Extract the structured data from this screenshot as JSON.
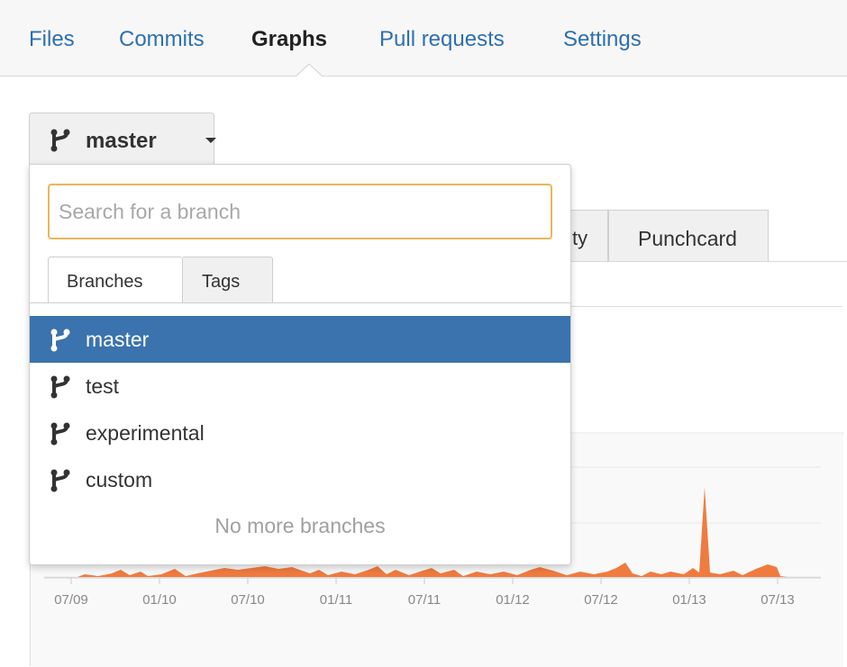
{
  "nav": {
    "tabs": [
      {
        "label": "Files"
      },
      {
        "label": "Commits"
      },
      {
        "label": "Graphs",
        "active": true
      },
      {
        "label": "Pull requests"
      },
      {
        "label": "Settings"
      }
    ]
  },
  "branch_selector": {
    "current": "master",
    "search_placeholder": "Search for a branch",
    "search_value": "",
    "tabs": [
      {
        "label": "Branches",
        "active": true
      },
      {
        "label": "Tags"
      }
    ],
    "branches": [
      {
        "name": "master",
        "selected": true
      },
      {
        "name": "test"
      },
      {
        "name": "experimental"
      },
      {
        "name": "custom"
      }
    ],
    "footer": "No more branches"
  },
  "background_tabs": {
    "partial_tab": "ty",
    "punchcard": "Punchcard"
  },
  "chart_data": {
    "type": "area",
    "x_tick_labels": [
      "07/09",
      "01/10",
      "07/10",
      "01/11",
      "07/11",
      "01/12",
      "07/12",
      "01/13",
      "07/13"
    ],
    "color": "#f07b3f",
    "grid": true
  },
  "colors": {
    "link": "#2e6fb1",
    "selected_bg": "#3a73ad",
    "search_border": "#e8b75a",
    "area": "#f07b3f"
  }
}
